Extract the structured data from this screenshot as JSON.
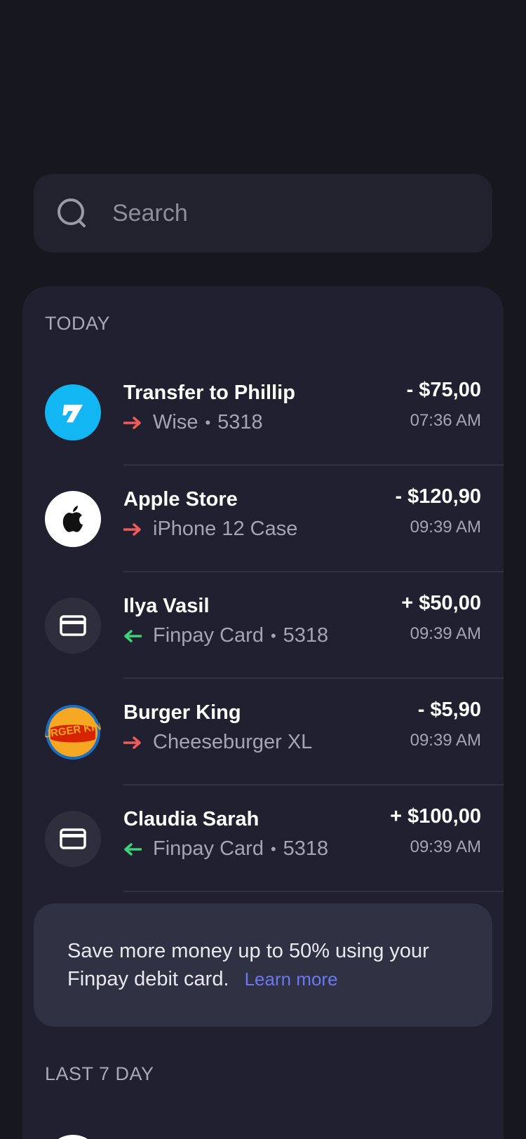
{
  "search": {
    "placeholder": "Search"
  },
  "sections": {
    "today": "TODAY",
    "last7": "LAST 7 DAY"
  },
  "colors": {
    "background": "#17171f",
    "panel": "#202030",
    "out_arrow": "#f05a5a",
    "in_arrow": "#3ed27a",
    "link": "#6a78f2",
    "wise_brand": "#11b6f2"
  },
  "transactions": [
    {
      "title": "Transfer to Phillip",
      "direction": "out",
      "icon": "wise-logo-icon",
      "method": "Wise",
      "last4": "5318",
      "amount": "- $75,00",
      "time": "07:36 AM"
    },
    {
      "title": "Apple Store",
      "direction": "out",
      "icon": "apple-logo-icon",
      "method": "iPhone 12 Case",
      "amount": "- $120,90",
      "time": "09:39 AM"
    },
    {
      "title": "Ilya Vasil",
      "direction": "in",
      "icon": "card-icon",
      "method": "Finpay Card",
      "last4": "5318",
      "amount": "+ $50,00",
      "time": "09:39 AM"
    },
    {
      "title": "Burger King",
      "direction": "out",
      "icon": "burger-king-logo-icon",
      "method": "Cheeseburger XL",
      "amount": "- $5,90",
      "time": "09:39 AM"
    },
    {
      "title": "Claudia Sarah",
      "direction": "in",
      "icon": "card-icon",
      "method": "Finpay Card",
      "last4": "5318",
      "amount": "+ $100,00",
      "time": "09:39 AM"
    }
  ],
  "promo": {
    "text": "Save more money up to 50% using your Finpay debit card.",
    "link": "Learn more"
  },
  "logos": {
    "burger_king": "BURGER KING"
  }
}
